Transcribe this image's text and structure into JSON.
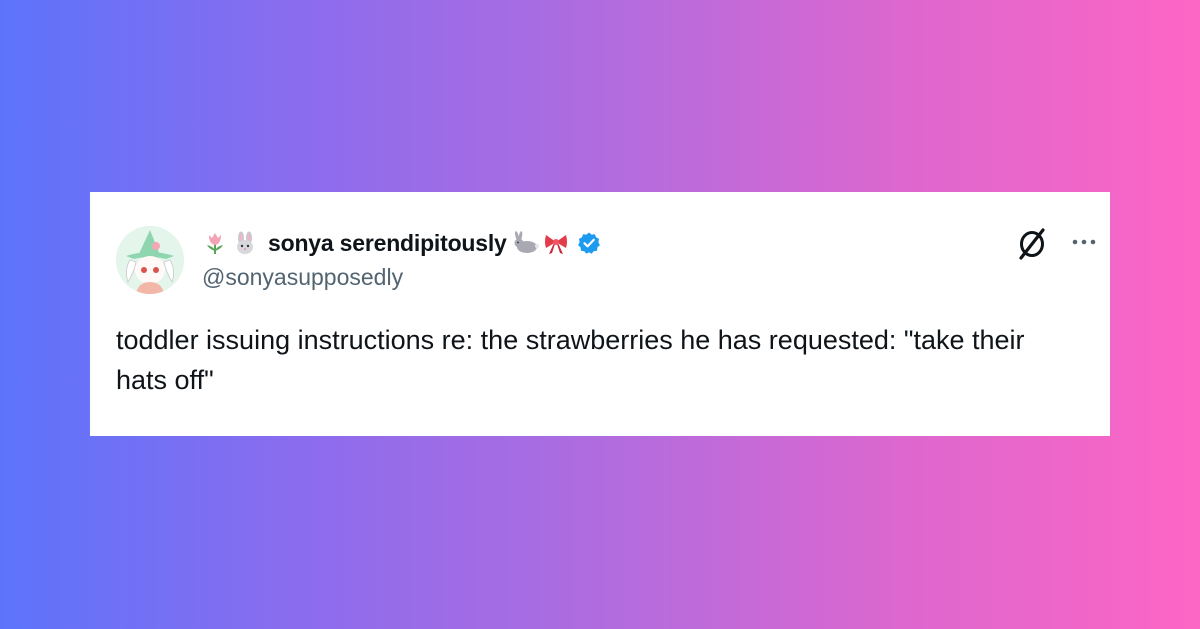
{
  "post": {
    "display_name": "sonya serendipitously",
    "handle": "@sonyasupposedly",
    "text": "toddler issuing instructions re: the strawberries he has requested: \"take their hats off\"",
    "name_prefix_emojis": [
      "tulip",
      "rabbit-face"
    ],
    "name_suffix_emojis": [
      "rabbit",
      "ribbon"
    ],
    "verified": true
  },
  "icons": {
    "brand": "x-logo-icon",
    "menu": "more-options-icon",
    "badge": "verified-badge-icon"
  },
  "colors": {
    "background_gradient": [
      "#5c74fb",
      "#fd66c4"
    ],
    "card_background": "#ffffff",
    "name_text": "#0f1419",
    "handle_text": "#536471",
    "verified_blue": "#1d9bf0"
  }
}
